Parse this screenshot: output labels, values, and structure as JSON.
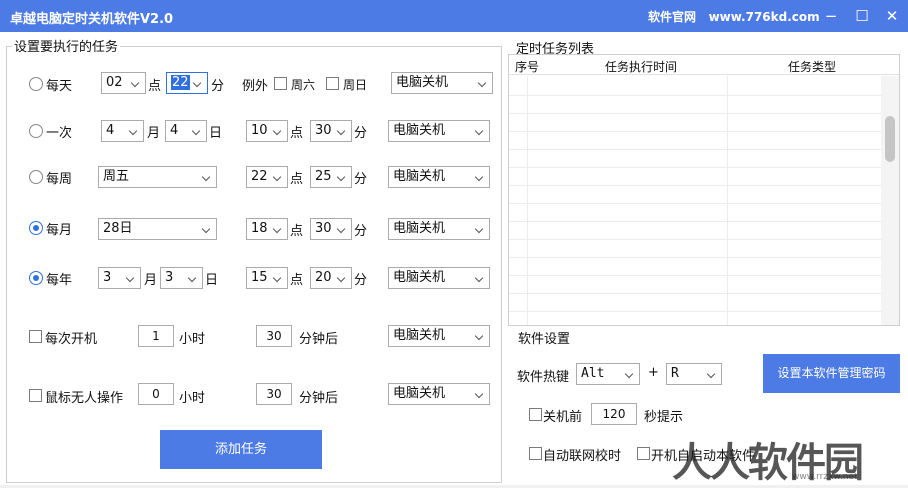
{
  "window": {
    "title": "卓越电脑定时关机软件V2.0",
    "site_label": "软件官网",
    "site_url": "www.776kd.com",
    "controls": {
      "minimize": "−",
      "maximize": "☐",
      "close": "✕"
    }
  },
  "tasks_group": {
    "label": "设置要执行的任务",
    "rows": {
      "daily": {
        "label": "每天",
        "hour": "02",
        "hour_unit": "点",
        "minute": "22",
        "minute_unit": "分",
        "except_label": "例外",
        "sat": "周六",
        "sun": "周日",
        "action": "电脑关机"
      },
      "once": {
        "label": "一次",
        "month": "4",
        "month_unit": "月",
        "day": "4",
        "day_unit": "日",
        "hour": "10",
        "hour_unit": "点",
        "minute": "30",
        "minute_unit": "分",
        "action": "电脑关机"
      },
      "weekly": {
        "label": "每周",
        "weekday": "周五",
        "hour": "22",
        "hour_unit": "点",
        "minute": "25",
        "minute_unit": "分",
        "action": "电脑关机"
      },
      "monthly": {
        "label": "每月",
        "day": "28日",
        "hour": "18",
        "hour_unit": "点",
        "minute": "30",
        "minute_unit": "分",
        "action": "电脑关机"
      },
      "yearly": {
        "label": "每年",
        "month": "3",
        "month_unit": "月",
        "day": "3",
        "day_unit": "日",
        "hour": "15",
        "hour_unit": "点",
        "minute": "20",
        "minute_unit": "分",
        "action": "电脑关机"
      },
      "boot": {
        "label": "每次开机",
        "hours": "1",
        "hours_unit": "小时",
        "minutes": "30",
        "minutes_unit": "分钟后",
        "action": "电脑关机"
      },
      "idle": {
        "label": "鼠标无人操作",
        "hours": "0",
        "hours_unit": "小时",
        "minutes": "30",
        "minutes_unit": "分钟后",
        "action": "电脑关机"
      }
    },
    "add_button": "添加任务"
  },
  "task_list": {
    "label": "定时任务列表",
    "columns": [
      "序号",
      "任务执行时间",
      "任务类型"
    ]
  },
  "settings": {
    "label": "软件设置",
    "hotkey_label": "软件热键",
    "hotkey_mod": "Alt",
    "plus": "+",
    "hotkey_key": "R",
    "password_button": "设置本软件管理密码",
    "prompt_before": "关机前",
    "prompt_seconds": "120",
    "prompt_after": "秒提示",
    "auto_sync": "自动联网校时",
    "autostart_partial": "开机自启动本软件"
  },
  "watermark": {
    "text": "人人软件园",
    "url": "www.rrzxw.net"
  }
}
